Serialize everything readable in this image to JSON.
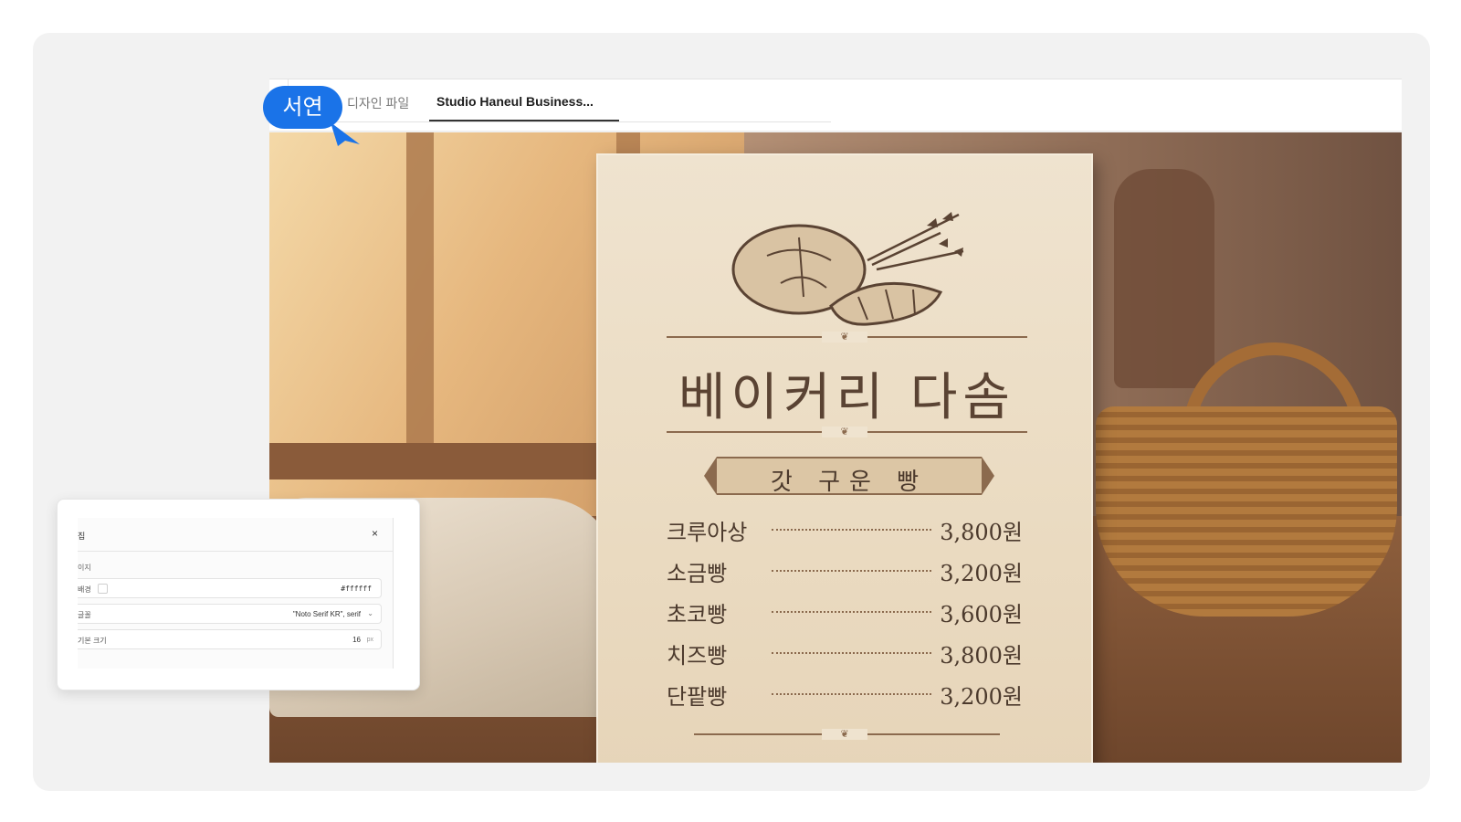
{
  "tabs": {
    "tab1_label": "디자인 파일",
    "tab2_label": "Studio Haneul Business..."
  },
  "menu": {
    "title": "베이커리 다솜",
    "section": "갓 구운 빵",
    "items": [
      {
        "name": "크루아상",
        "price": "3,800원"
      },
      {
        "name": "소금빵",
        "price": "3,200원"
      },
      {
        "name": "초코빵",
        "price": "3,600원"
      },
      {
        "name": "치즈빵",
        "price": "3,800원"
      },
      {
        "name": "단팥빵",
        "price": "3,200원"
      }
    ]
  },
  "panel": {
    "title": "집",
    "close": "×",
    "section": "이지",
    "background_label": "배경",
    "background_value": "#ffffff",
    "font_label": "글꼴",
    "font_value": "\"Noto Serif KR\", serif",
    "size_label": "기본 크기",
    "size_value": "16",
    "size_unit": "px"
  },
  "cursor": {
    "label": "서연",
    "color": "#1a73e8"
  }
}
